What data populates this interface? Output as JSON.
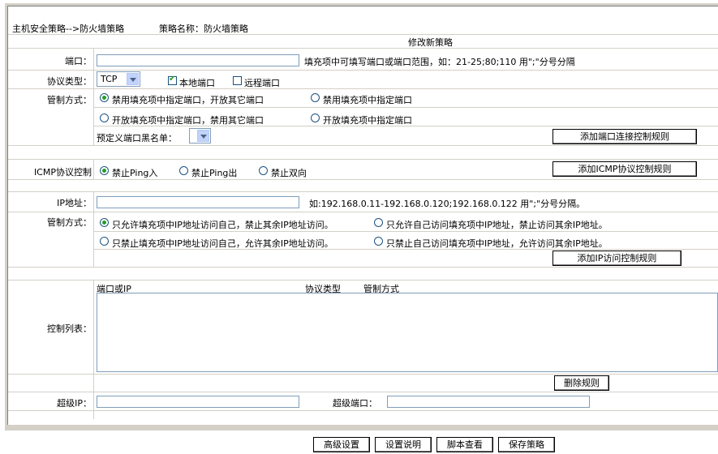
{
  "header": {
    "breadcrumb": "主机安全策略-->防火墙策略",
    "policy_name": "策略名称：防火墙策略",
    "form_title": "修改新策略"
  },
  "port_section": {
    "port_label": "端口：",
    "port_value": "",
    "port_hint": "填充项中可填写端口或端口范围，如：21-25;80;110 用\";\"分号分隔",
    "protocol_label": "协议类型：",
    "protocol_selected": "TCP",
    "local_port_label": "本地端口",
    "local_port_checked": true,
    "remote_port_label": "远程端口",
    "remote_port_checked": false,
    "control_label": "管制方式：",
    "options": [
      {
        "label": "禁用填充项中指定端口，开放其它端口",
        "checked": true
      },
      {
        "label": "禁用填充项中指定端口",
        "checked": false
      },
      {
        "label": "开放填充项中指定端口，禁用其它端口",
        "checked": false
      },
      {
        "label": "开放填充项中指定端口",
        "checked": false
      }
    ],
    "blacklist_label": "预定义端口黑名单：",
    "blacklist_selected": "",
    "add_button": "添加端口连接控制规则"
  },
  "icmp_section": {
    "label": "ICMP协议控制",
    "options": [
      {
        "label": "禁止Ping入",
        "checked": true
      },
      {
        "label": "禁止Ping出",
        "checked": false
      },
      {
        "label": "禁止双向",
        "checked": false
      }
    ],
    "add_button": "添加ICMP协议控制规则"
  },
  "ip_section": {
    "ip_label": "IP地址：",
    "ip_value": "",
    "ip_hint": "如:192.168.0.11-192.168.0.120;192.168.0.122 用\";\"分号分隔。",
    "control_label": "管制方式：",
    "options": [
      {
        "label": "只允许填充项中IP地址访问自己，禁止其余IP地址访问。",
        "checked": true
      },
      {
        "label": "只允许自己访问填充项中IP地址，禁止访问其余IP地址。",
        "checked": false
      },
      {
        "label": "只禁止填充项中IP地址访问自己，允许其余IP地址访问。",
        "checked": false
      },
      {
        "label": "只禁止自己访问填充项中IP地址，允许访问其余IP地址。",
        "checked": false
      }
    ],
    "add_button": "添加IP访问控制规则"
  },
  "control_list": {
    "label": "控制列表：",
    "columns": [
      "端口或IP",
      "协议类型",
      "管制方式"
    ],
    "rows": [],
    "delete_button": "删除规则"
  },
  "super": {
    "super_ip_label": "超级IP：",
    "super_ip_value": "",
    "super_port_label": "超级端口：",
    "super_port_value": ""
  },
  "footer": {
    "buttons": [
      "高级设置",
      "设置说明",
      "脚本查看",
      "保存策略"
    ]
  }
}
